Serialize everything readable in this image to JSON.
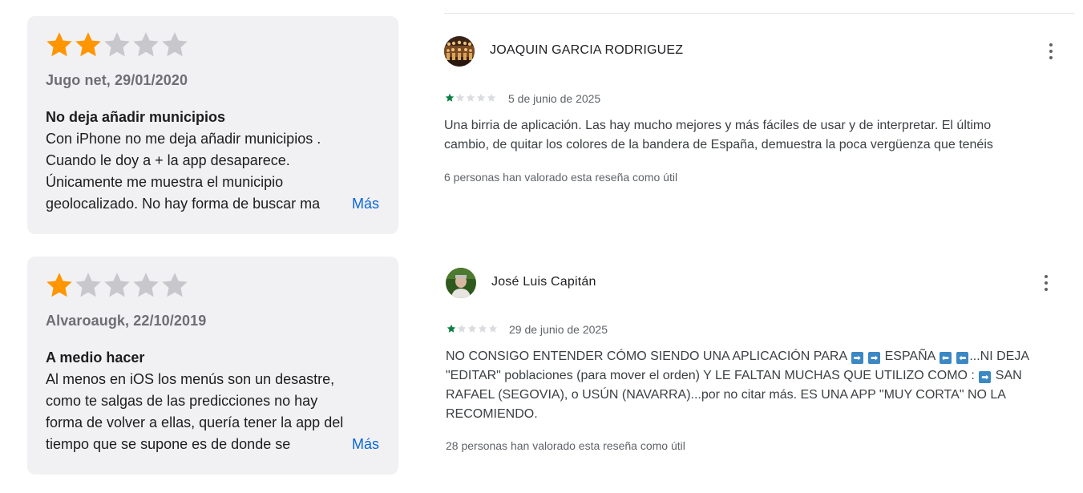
{
  "apple_reviews": [
    {
      "rating": 2,
      "max_rating": 5,
      "meta": "Jugo net, 29/01/2020",
      "title": "No deja añadir municipios",
      "lines": [
        "Con iPhone no me deja añadir municipios .",
        "Cuando le doy a + la app desaparece.",
        "Únicamente me muestra el municipio",
        "geolocalizado. No hay forma de buscar ma"
      ],
      "more_label": "Más"
    },
    {
      "rating": 1,
      "max_rating": 5,
      "meta": "Alvaroaugk, 22/10/2019",
      "title": "A medio hacer",
      "lines": [
        "Al menos en iOS los menús son un desastre,",
        "como te salgas de las predicciones no hay",
        "forma de volver a ellas, quería tener la app del",
        "tiempo que se supone es de donde se"
      ],
      "more_label": "Más"
    }
  ],
  "google_reviews": [
    {
      "author": "JOAQUIN GARCIA RODRIGUEZ",
      "avatar_icon": "photo-avatar-icon",
      "rating": 1,
      "max_rating": 5,
      "date": "5 de junio de 2025",
      "lines": [
        "Una birria de aplicación. Las hay mucho mejores y más fáciles de usar y de interpretar. El último",
        "cambio, de quitar los colores de la bandera de España, demuestra la poca vergüenza que tenéis"
      ],
      "helpful": "6 personas han valorado esta reseña como útil",
      "menu_icon": "more-vert-icon"
    },
    {
      "author": "José Luis Capitán",
      "avatar_icon": "photo-avatar-icon",
      "rating": 1,
      "max_rating": 5,
      "date": "29 de junio de 2025",
      "text": {
        "l1_a": "NO CONSIGO ENTENDER CÓMO SIENDO UNA APLICACIÓN PARA",
        "l1_b": "ESPAÑA",
        "l1_c": "...NI DEJA",
        "l2_a": "\"EDITAR\" poblaciones (para mover el orden) Y LE FALTAN MUCHAS QUE UTILIZO COMO :",
        "l2_b": "SAN",
        "l3": "RAFAEL (SEGOVIA), o USÚN (NAVARRA)...por no citar más. ES UNA APP \"MUY CORTA\" NO LA",
        "l4": "RECOMIENDO."
      },
      "helpful": "28 personas han valorado esta reseña como útil",
      "menu_icon": "more-vert-icon"
    }
  ],
  "colors": {
    "apple_star_filled": "#ff9500",
    "apple_star_empty": "#c7c7cc",
    "google_star_filled": "#0b8043",
    "google_star_empty": "#dadce0",
    "more_link": "#0a66d6",
    "emoji_arrow_bg": "#3b88c3"
  },
  "emoji": {
    "right_arrow": "➡",
    "left_arrow": "⬅"
  }
}
